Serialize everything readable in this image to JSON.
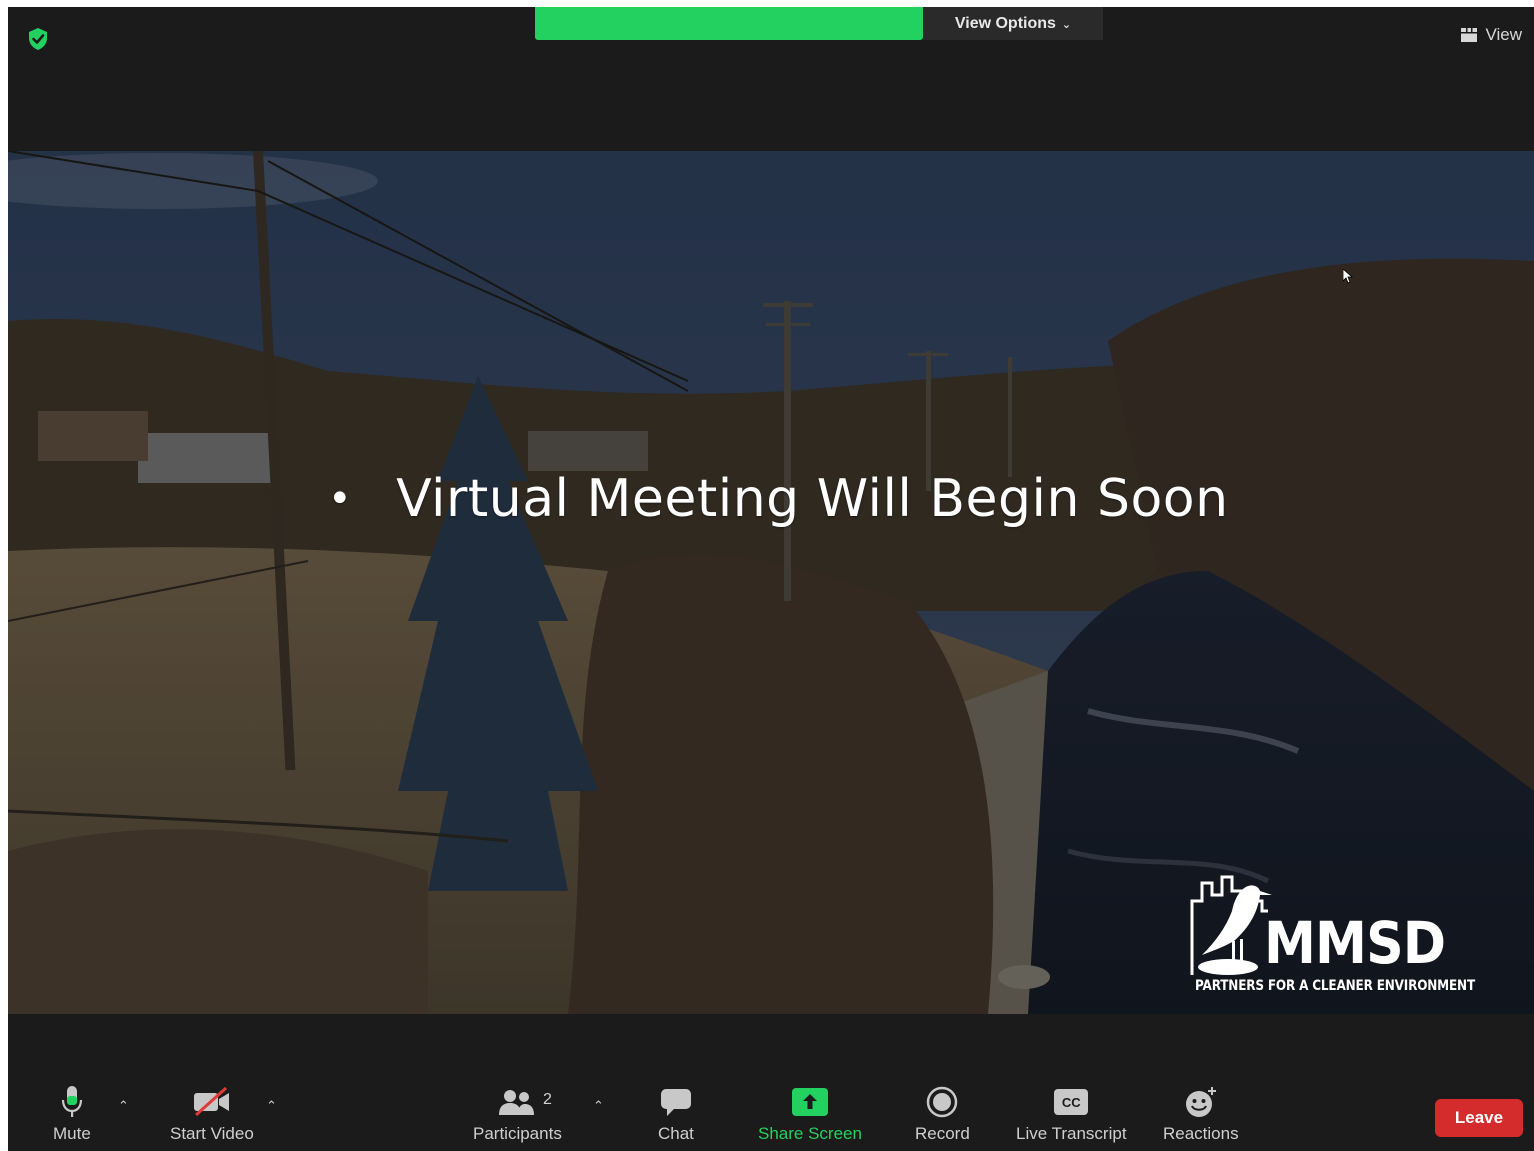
{
  "top_bar": {
    "security_icon": "shield-check-icon",
    "view_options_label": "View Options",
    "view_label": "View"
  },
  "slide": {
    "bullet": "•",
    "headline": "Virtual Meeting Will Begin Soon",
    "logo": {
      "name": "MMSD",
      "tagline": "PARTNERS FOR A CLEANER ENVIRONMENT"
    }
  },
  "toolbar": {
    "mute_label": "Mute",
    "start_video_label": "Start Video",
    "participants_label": "Participants",
    "participants_count": "2",
    "chat_label": "Chat",
    "share_screen_label": "Share Screen",
    "record_label": "Record",
    "live_transcript_label": "Live Transcript",
    "cc_glyph": "CC",
    "reactions_label": "Reactions",
    "leave_label": "Leave"
  },
  "colors": {
    "accent_green": "#23d160",
    "leave_red": "#d42c2c",
    "toolbar_bg": "#1b1b1b"
  }
}
